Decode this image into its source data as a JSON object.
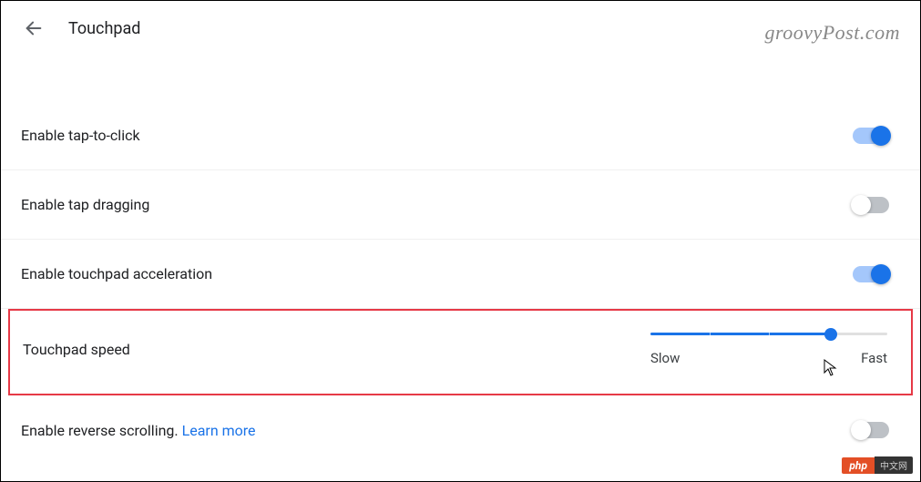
{
  "header": {
    "title": "Touchpad"
  },
  "watermark": "groovyPost.com",
  "rows": {
    "tap_to_click": {
      "label": "Enable tap-to-click",
      "on": true
    },
    "tap_dragging": {
      "label": "Enable tap dragging",
      "on": false
    },
    "acceleration": {
      "label": "Enable touchpad acceleration",
      "on": true
    },
    "speed": {
      "label": "Touchpad speed",
      "slow_label": "Slow",
      "fast_label": "Fast",
      "value_percent": 76
    },
    "reverse_scroll": {
      "label": "Enable reverse scrolling. ",
      "link_text": "Learn more",
      "on": false
    }
  },
  "badge": {
    "left": "php",
    "right": "中文网"
  }
}
